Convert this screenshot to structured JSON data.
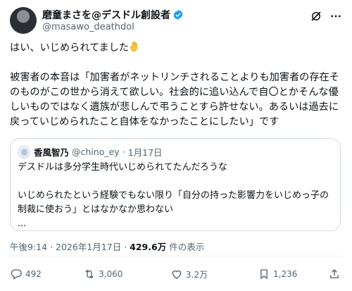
{
  "author": {
    "display_name": "磨童まさを@デスドル創設者",
    "handle": "@masawo_deathdol"
  },
  "tweet": {
    "line1": "はい、いじめられてました",
    "body": "被害者の本音は「加害者がネットリンチされることよりも加害者の存在そのものがこの世から消えて欲しい。社会的に追い込んで自〇とかそんな優しいものではなく遺族が悲しんで弔うことすら許せない。あるいは過去に戻っていじめられたこと自体をなかったことにしたい」です"
  },
  "quote": {
    "name": "香風智乃",
    "handle": "@chino_ey",
    "separator": "·",
    "date": "1月17日",
    "text": "デスドルは多分学生時代いじめられてたんだろうな\n\nいじめられたという経験でもない限り「自分の持った影響力をいじめっ子の制裁に使おう」とはなかなか思わない\n..."
  },
  "meta": {
    "time": "午後9:14",
    "dot1": "·",
    "date": "2026年1月17日",
    "dot2": "·",
    "views": "429.6万",
    "views_label": "件の表示"
  },
  "actions": {
    "replies": "492",
    "reposts": "3,060",
    "likes": "3.2万",
    "bookmarks": "1,236"
  },
  "colors": {
    "verified": "#1d9bf0",
    "muted": "#536471",
    "hand": "#f5c242"
  },
  "icons": [
    "verified-badge-icon",
    "grok-icon",
    "more-icon",
    "raised-hand-icon",
    "reply-icon",
    "repost-icon",
    "like-icon",
    "bookmark-icon",
    "share-icon"
  ]
}
